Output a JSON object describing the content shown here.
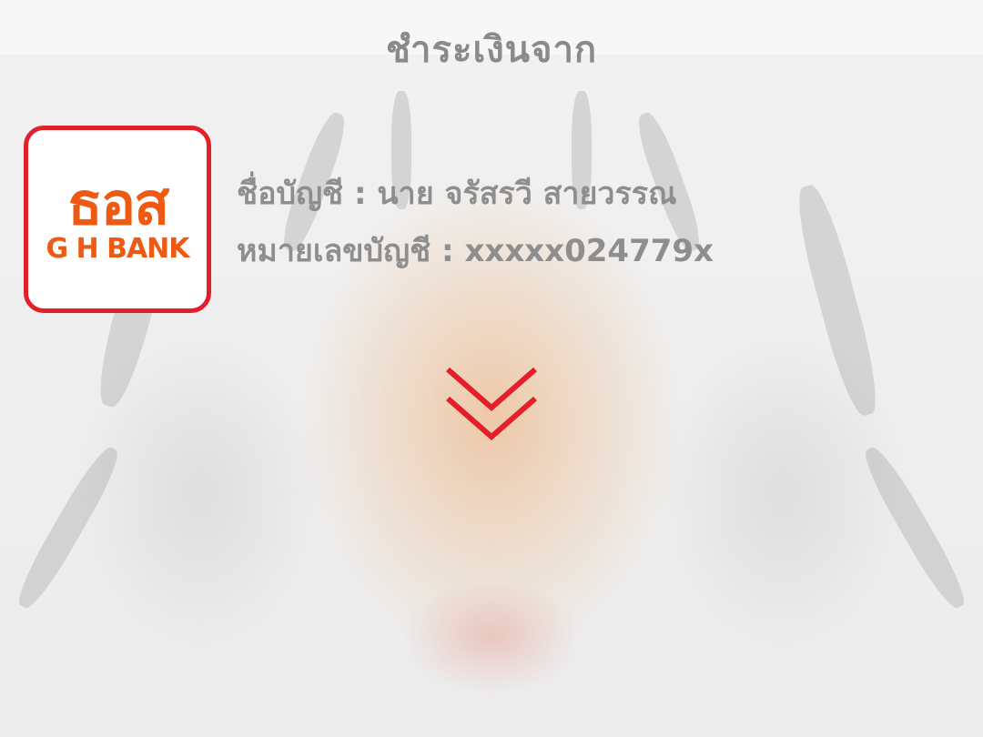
{
  "header": {
    "title": "ชำระเงินจาก"
  },
  "bank": {
    "logo_text_main": "ธอส",
    "logo_text_sub": "G H BANK",
    "logo_color": "#ee5a14",
    "logo_border_color": "#e3202a"
  },
  "account": {
    "name_label": "ชื่อบัญชี :",
    "name_value": "นาย จรัสรวี สายวรรณ",
    "number_label": "หมายเลขบัญชี :",
    "number_value": "xxxxx024779x"
  },
  "indicator": {
    "icon": "double-chevron-down-icon",
    "color": "#e3202a"
  }
}
